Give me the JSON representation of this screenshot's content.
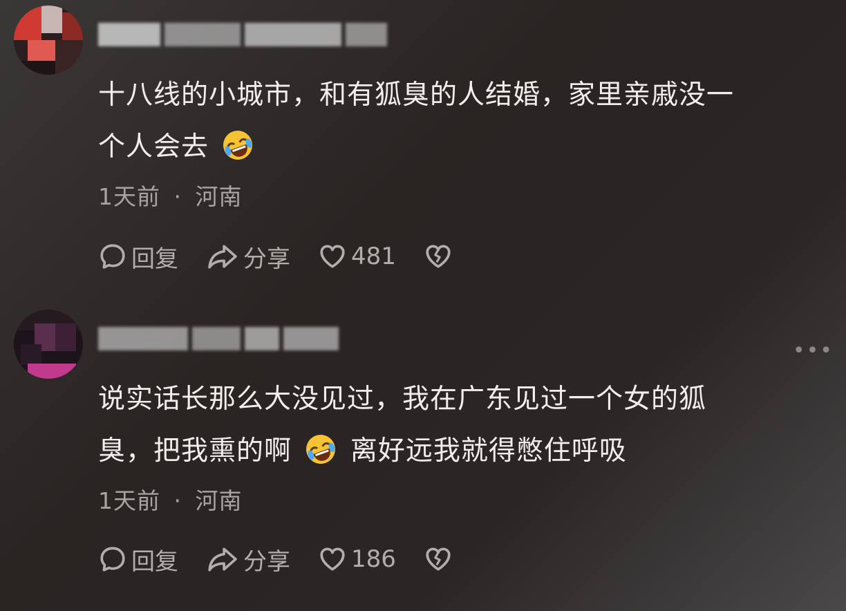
{
  "comments": [
    {
      "username": "嘴新██浪 ███吧█",
      "text_line1": "十八线的小城市，和有狐臭的人结婚，家里亲戚没一",
      "text_line2a": "个人会去",
      "emoji": "rolling-on-floor-laughing-emoji",
      "text_line2b": "",
      "time": "1天前",
      "separator": "·",
      "location": "河南",
      "reply_label": "回复",
      "share_label": "分享",
      "like_count": "481"
    },
    {
      "username": "██吧█ 新███",
      "text_line1": "说实话长那么大没见过，我在广东见过一个女的狐",
      "text_line2a": "臭，把我熏的啊",
      "emoji": "rolling-on-floor-laughing-emoji",
      "text_line2b": "离好远我就得憋住呼吸",
      "time": "1天前",
      "separator": "·",
      "location": "河南",
      "reply_label": "回复",
      "share_label": "分享",
      "like_count": "186",
      "more_label": "•••"
    }
  ],
  "colors": {
    "text": "#f1eeec",
    "meta": "#a9a4a2",
    "action": "#b3aeac"
  }
}
